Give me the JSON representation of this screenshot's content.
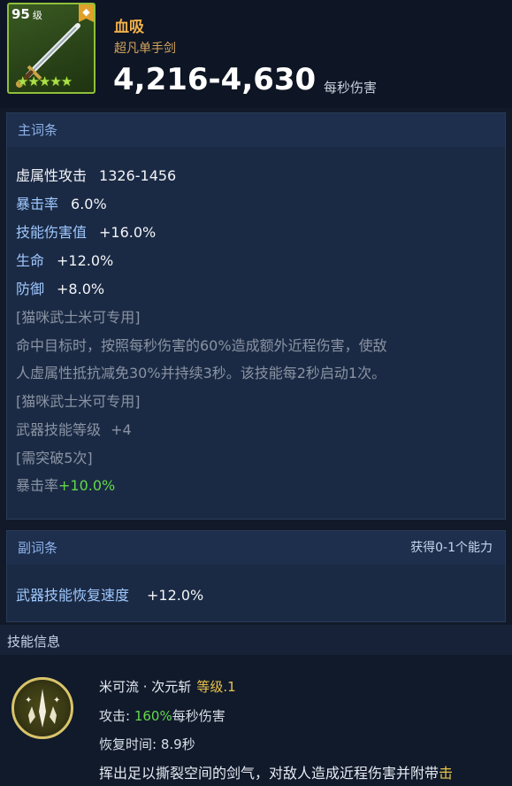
{
  "item": {
    "level_number": "95",
    "level_unit": "级",
    "stars": "★★★★★",
    "name": "血吸",
    "type": "超凡单手剑",
    "dps": "4,216-4,630",
    "dps_label": "每秒伤害"
  },
  "main_affix": {
    "header": "主词条",
    "stats": [
      {
        "label": "虚属性攻击",
        "value": "1326-1456"
      },
      {
        "label": "暴击率",
        "value": "6.0%"
      },
      {
        "label": "技能伤害值",
        "value": "+16.0%"
      },
      {
        "label": "生命",
        "value": "+12.0%"
      },
      {
        "label": "防御",
        "value": "+8.0%"
      }
    ],
    "tag1": "[猫咪武士米可专用]",
    "effect_line1": "命中目标时，按照每秒伤害的60%造成额外近程伤害，使敌",
    "effect_line2": "人虚属性抵抗减免30%并持续3秒。该技能每2秒启动1次。",
    "tag2": "[猫咪武士米可专用]",
    "skill_level_label": "武器技能等级",
    "skill_level_value": "+4",
    "requirement": "[需突破5次]",
    "crit_label": "暴击率",
    "crit_value": "+10.0%"
  },
  "sub_affix": {
    "header": "副词条",
    "header_right": "获得0-1个能力",
    "stat_label": "武器技能恢复速度",
    "stat_value": "+12.0%"
  },
  "skill": {
    "section_title": "技能信息",
    "name": "米可流 · 次元斩",
    "level": "等级.1",
    "attack_label": "攻击:",
    "attack_value": "160%",
    "attack_suffix": "每秒伤害",
    "cooldown_label": "恢复时间:",
    "cooldown_value": "8.9秒",
    "description": "挥出足以撕裂空间的剑气，对敌人造成近程伤害并附带",
    "description_highlight": "击"
  },
  "colors": {
    "accent_orange": "#f0b04a",
    "stat_blue": "#9ec8ff",
    "bonus_green": "#62d84a",
    "rarity_green": "#8fbf3a"
  },
  "icons": {
    "item": "sword-icon",
    "badge": "diamond-badge-icon",
    "skill": "burst-emblem-icon"
  }
}
